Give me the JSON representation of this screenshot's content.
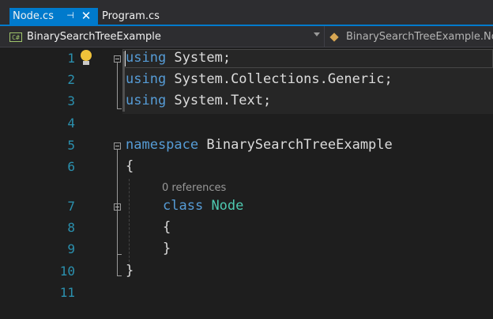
{
  "tabs": [
    {
      "label": "Node.cs",
      "active": true,
      "pin_icon": "pin-icon",
      "close_icon": "close-icon"
    },
    {
      "label": "Program.cs",
      "active": false
    }
  ],
  "navbar": {
    "project_icon": "csharp-project-icon",
    "project": "BinarySearchTreeExample",
    "member_icon": "class-icon",
    "member": "BinarySearchTreeExample.No"
  },
  "editor": {
    "line_numbers": [
      "1",
      "2",
      "3",
      "4",
      "5",
      "6",
      "7",
      "8",
      "9",
      "10",
      "11"
    ],
    "lines": [
      {
        "kw": "using",
        "rest": " System;"
      },
      {
        "kw": "using",
        "rest": " System.Collections.Generic;"
      },
      {
        "kw": "using",
        "rest": " System.Text;"
      },
      {
        "kw": "namespace",
        "rest": " BinarySearchTreeExample"
      },
      {
        "text": "{"
      },
      {
        "kw": "class",
        "type": "Node"
      },
      {
        "text": "{"
      },
      {
        "text": "}"
      },
      {
        "text": "}"
      }
    ],
    "codelens": "0 references",
    "lightbulb_icon": "lightbulb-icon"
  },
  "colors": {
    "keyword": "#569cd6",
    "type": "#4ec9b0",
    "line_number": "#2b91af",
    "accent": "#007acc"
  }
}
